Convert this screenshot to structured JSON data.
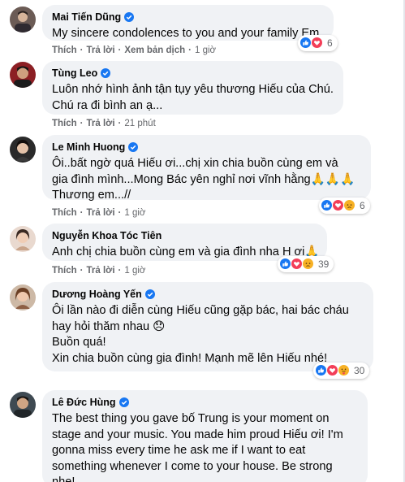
{
  "colors": {
    "bubble_bg": "#f0f2f5",
    "name": "#050505",
    "meta": "#65676b",
    "verified": "#1877f2",
    "like": "#1877f2",
    "love": "#f33e58",
    "sad": "#f7b125"
  },
  "comments": [
    {
      "author": "Mai Tiến Dũng",
      "verified": true,
      "lines": [
        "My sincere condolences to you and your family Em."
      ],
      "actions": {
        "like": "Thích",
        "reply": "Trả lời",
        "translate": "Xem bản dịch",
        "time": "1 giờ"
      },
      "reactions": {
        "icons": [
          "like-icon",
          "love-icon"
        ],
        "count": "6"
      }
    },
    {
      "author": "Tùng Leo",
      "verified": true,
      "lines": [
        "Luôn nhớ hình ảnh tận tụy yêu thương Hiếu của Chú.",
        "Chú ra đi bình an ạ..."
      ],
      "actions": {
        "like": "Thích",
        "reply": "Trả lời",
        "time": "21 phút"
      }
    },
    {
      "author": "Le Minh Huong",
      "verified": true,
      "lines": [
        "Ôi..bất ngờ quá Hiếu ơi...chị xin chia buồn cùng em và",
        "gia đình mình...Mong Bác yên nghỉ nơi vĩnh hằng🙏🙏🙏",
        "Thương em...//"
      ],
      "actions": {
        "like": "Thích",
        "reply": "Trả lời",
        "time": "1 giờ"
      },
      "reactions": {
        "icons": [
          "like-icon",
          "love-icon",
          "sad-icon"
        ],
        "count": "6"
      }
    },
    {
      "author": "Nguyễn Khoa Tóc Tiên",
      "verified": false,
      "lines": [
        "Anh chị chia buồn cùng em và gia đình nha H ơi🙏"
      ],
      "actions": {
        "like": "Thích",
        "reply": "Trả lời",
        "time": "1 giờ"
      },
      "reactions": {
        "icons": [
          "like-icon",
          "love-icon",
          "sad-icon"
        ],
        "count": "39"
      }
    },
    {
      "author": "Dương Hoàng Yến",
      "verified": true,
      "lines": [
        "Ôi lần nào đi diễn cùng Hiếu cũng gặp bác, hai bác cháu",
        "hay hỏi thăm nhau 😞",
        "Buồn quá!",
        "Xin chia buồn cùng gia đình! Mạnh mẽ lên Hiếu nhé!"
      ],
      "reactions": {
        "icons": [
          "like-icon",
          "love-icon",
          "care-icon"
        ],
        "count": "30"
      }
    },
    {
      "author": "Lê Đức Hùng",
      "verified": true,
      "lines": [
        "The best thing you gave bố Trung is your moment on",
        "stage and your music. You made him proud Hiếu ơi! I'm",
        "gonna miss every time he ask me if I want to eat",
        "something whenever I come to your house. Be strong",
        "nhe!"
      ]
    }
  ]
}
